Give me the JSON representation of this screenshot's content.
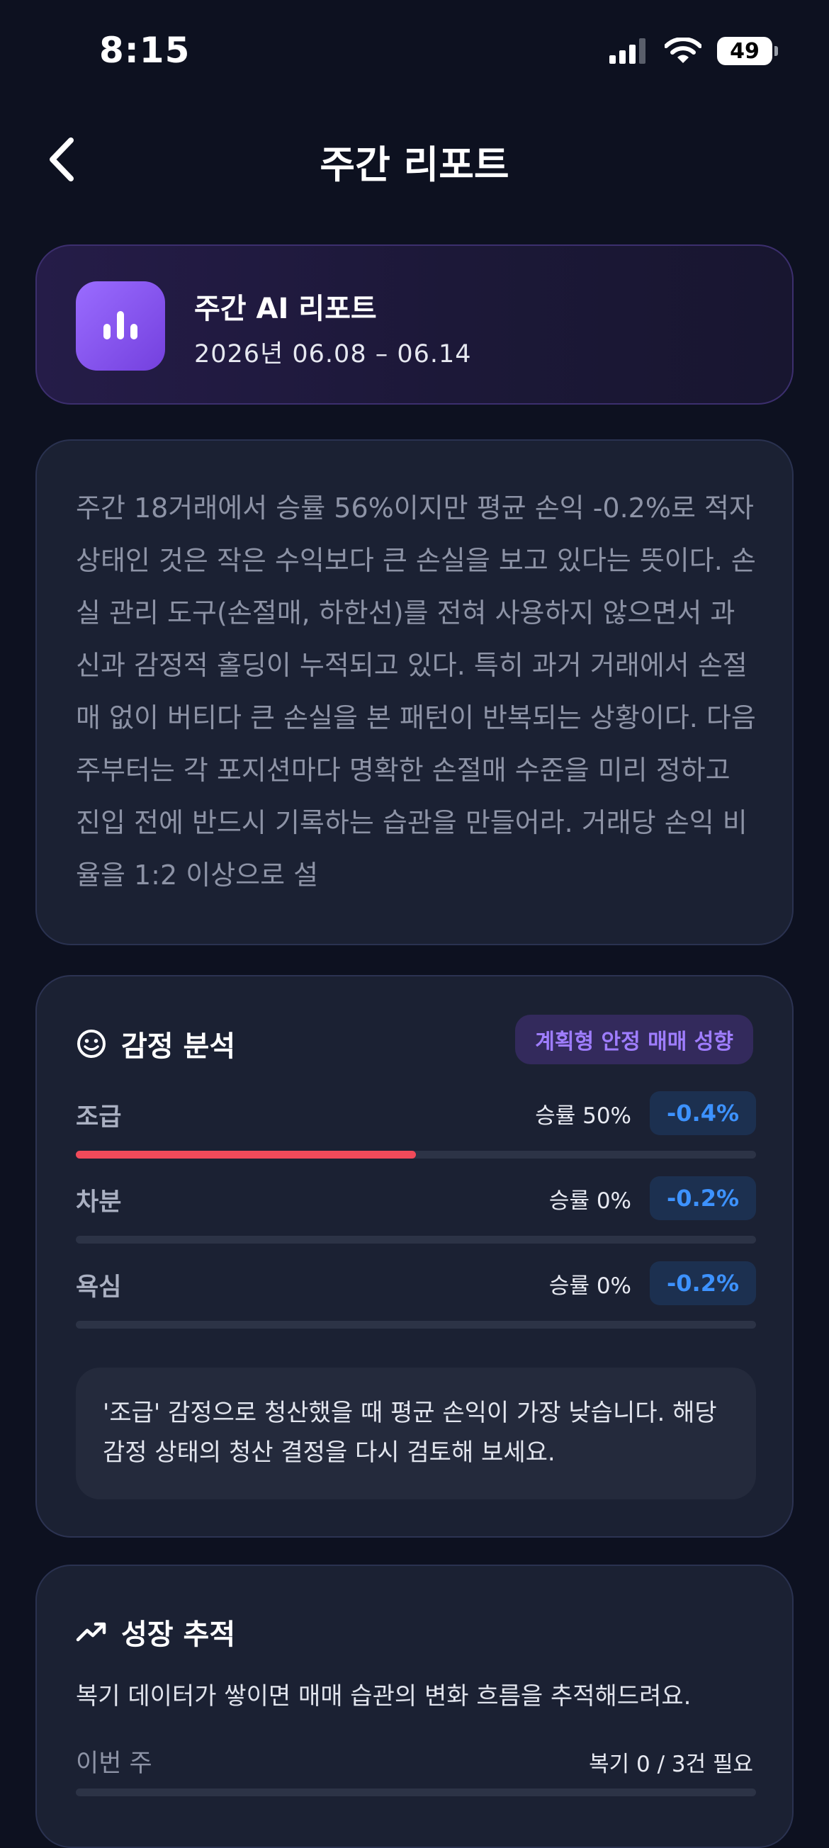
{
  "status_bar": {
    "time": "8:15",
    "battery": "49"
  },
  "nav": {
    "title": "주간 리포트"
  },
  "header": {
    "title": "주간 AI 리포트",
    "date": "2026년  06.08 – 06.14"
  },
  "summary": {
    "text": "주간 18거래에서 승률 56%이지만 평균 손익 -0.2%로 적자 상태인 것은 작은 수익보다 큰 손실을 보고 있다는 뜻이다. 손실 관리 도구(손절매, 하한선)를 전혀 사용하지 않으면서 과신과 감정적 홀딩이 누적되고 있다. 특히 과거 거래에서 손절매 없이 버티다 큰 손실을 본 패턴이 반복되는 상황이다. 다음 주부터는 각 포지션마다 명확한 손절매 수준을 미리 정하고 진입 전에 반드시 기록하는 습관을 만들어라. 거래당 손익 비율을 1:2 이상으로 설"
  },
  "emotion": {
    "title": "감정 분석",
    "badge": "계획형 안정 매매 성향",
    "rows": [
      {
        "label": "조급",
        "win_rate": "승률 50%",
        "pnl": "-0.4%",
        "progress": 0.5
      },
      {
        "label": "차분",
        "win_rate": "승률 0%",
        "pnl": "-0.2%",
        "progress": 0
      },
      {
        "label": "욕심",
        "win_rate": "승률 0%",
        "pnl": "-0.2%",
        "progress": 0
      }
    ],
    "insight": "'조급' 감정으로 청산했을 때 평균 손익이 가장 낮습니다. 해당 감정 상태의 청산 결정을 다시 검토해 보세요."
  },
  "growth": {
    "title": "성장 추적",
    "description": "복기 데이터가 쌓이면 매매 습관의 변화 흐름을 추적해드려요.",
    "this_week_label": "이번 주",
    "requirement": "복기 0 / 3건 필요",
    "progress": 0
  },
  "colors": {
    "accent_purple": "#8b5cf6",
    "loss_red": "#f04a5a",
    "pnl_blue": "#3d92ff"
  }
}
